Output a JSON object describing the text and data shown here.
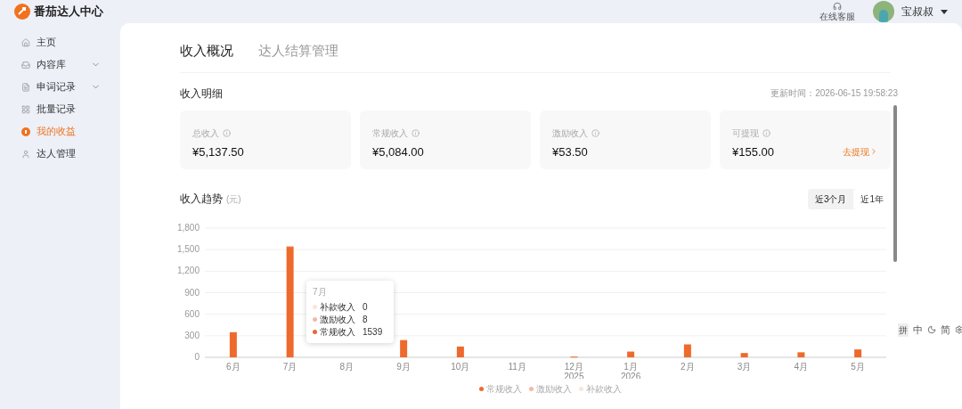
{
  "header": {
    "logo": "番茄达人中心",
    "support": "在线客服",
    "user": "宝叔叔"
  },
  "sidebar": {
    "items": [
      {
        "label": "主页",
        "expandable": false,
        "selected": false
      },
      {
        "label": "内容库",
        "expandable": true,
        "selected": false
      },
      {
        "label": "申词记录",
        "expandable": true,
        "selected": false
      },
      {
        "label": "批量记录",
        "expandable": false,
        "selected": false
      },
      {
        "label": "我的收益",
        "expandable": false,
        "selected": true
      },
      {
        "label": "达人管理",
        "expandable": false,
        "selected": false
      }
    ]
  },
  "tabs": [
    {
      "label": "收入概况",
      "selected": true
    },
    {
      "label": "达人结算管理",
      "selected": false
    }
  ],
  "detail": {
    "title": "收入明细",
    "updated": "更新时间：2026-06-15 19:58:23",
    "cards": [
      {
        "label": "总收入",
        "value": "¥5,137.50"
      },
      {
        "label": "常规收入",
        "value": "¥5,084.00"
      },
      {
        "label": "激励收入",
        "value": "¥53.50"
      },
      {
        "label": "可提现",
        "value": "¥155.00",
        "action": "去提现"
      }
    ]
  },
  "trend": {
    "title": "收入趋势",
    "unit": "(元)",
    "ranges": [
      {
        "label": "近3个月",
        "selected": true
      },
      {
        "label": "近1年",
        "selected": false
      }
    ],
    "chart_data": {
      "type": "bar",
      "stacked": true,
      "grid": true,
      "categories": [
        "6月",
        "7月",
        "8月",
        "9月",
        "10月",
        "11月",
        "12月\n2025",
        "1月\n2026",
        "2月",
        "3月",
        "4月",
        "5月"
      ],
      "series": [
        {
          "name": "常规收入",
          "color": "#ee6a2c",
          "values": [
            350,
            1540,
            0,
            240,
            150,
            0,
            10,
            80,
            180,
            60,
            70,
            110
          ]
        },
        {
          "name": "激励收入",
          "color": "#f4b9a2",
          "values": [
            0,
            10,
            0,
            0,
            0,
            0,
            0,
            0,
            0,
            0,
            0,
            0
          ]
        },
        {
          "name": "补款收入",
          "color": "#fbe4d8",
          "values": [
            0,
            0,
            0,
            0,
            0,
            0,
            0,
            0,
            0,
            0,
            0,
            0
          ]
        }
      ],
      "ylim": [
        0,
        1800
      ],
      "yticks": [
        {
          "value": 0,
          "label": "0"
        },
        {
          "value": 300,
          "label": "300"
        },
        {
          "value": 600,
          "label": "600"
        },
        {
          "value": 900,
          "label": "900"
        },
        {
          "value": 1200,
          "label": "1,200"
        },
        {
          "value": 1500,
          "label": "1,500"
        },
        {
          "value": 1800,
          "label": "1,800"
        }
      ]
    },
    "tooltip": {
      "title": "7月",
      "rows": [
        {
          "name": "补款收入",
          "value": "0",
          "color": "#fbe4d8"
        },
        {
          "name": "激励收入",
          "value": "8",
          "color": "#f4b9a2"
        },
        {
          "name": "常规收入",
          "value": "1539",
          "color": "#e4683a"
        }
      ]
    }
  },
  "ime_bar": [
    "拼",
    "中",
    "简"
  ]
}
